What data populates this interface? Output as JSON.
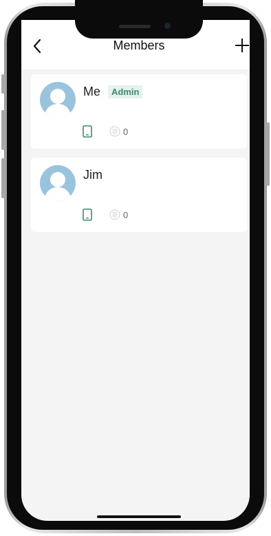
{
  "header": {
    "title": "Members",
    "back_icon": "chevron-left-icon",
    "add_icon": "plus-icon"
  },
  "members": [
    {
      "name": "Me",
      "role_badge": "Admin",
      "device_icon": "phone-icon",
      "keypad_icon": "keypad-icon",
      "count": "0"
    },
    {
      "name": "Jim",
      "role_badge": "",
      "device_icon": "phone-icon",
      "keypad_icon": "keypad-icon",
      "count": "0"
    }
  ],
  "colors": {
    "accent_green": "#3b8a6d",
    "badge_bg": "#e6f2ec",
    "avatar_bg": "#9ac3de",
    "screen_bg": "#f4f4f4"
  }
}
